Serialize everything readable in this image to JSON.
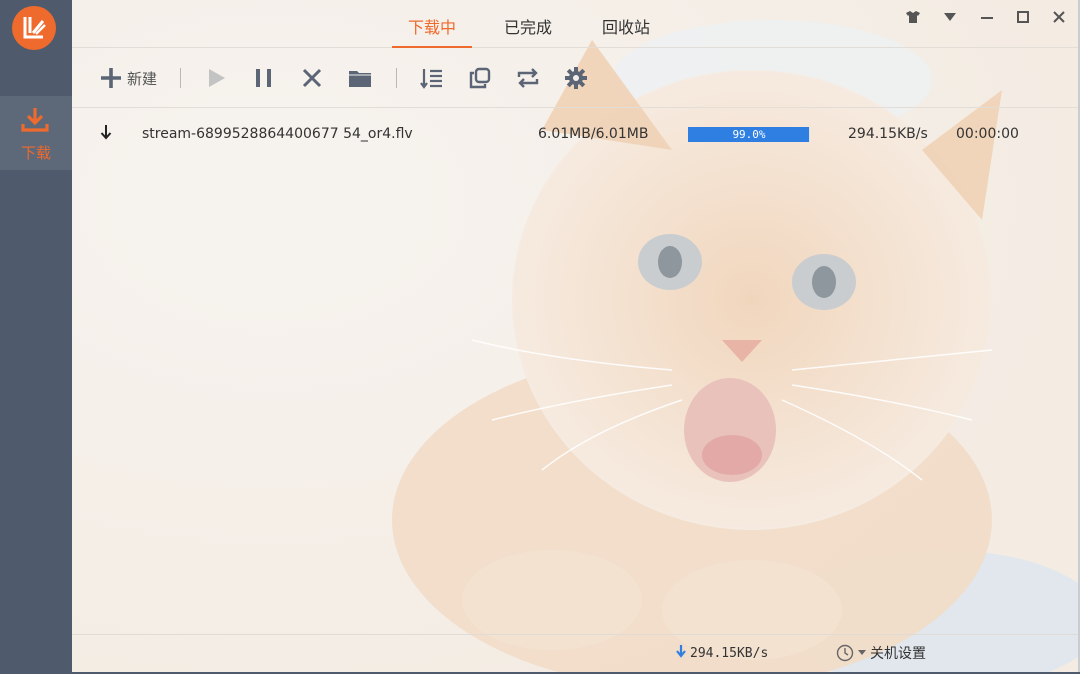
{
  "sidebar": {
    "logo_icon": "app-logo",
    "items": [
      {
        "label": "下载",
        "icon": "download-icon",
        "active": true
      }
    ]
  },
  "tabs": [
    {
      "label": "下载中",
      "active": true
    },
    {
      "label": "已完成",
      "active": false
    },
    {
      "label": "回收站",
      "active": false
    }
  ],
  "window_controls": [
    "skin-icon",
    "menu-dropdown-icon",
    "minimize-icon",
    "maximize-icon",
    "close-icon"
  ],
  "toolbar": {
    "new_label": "新建",
    "buttons": [
      "plus-icon",
      "play-icon",
      "pause-icon",
      "delete-icon",
      "folder-icon",
      "sort-icon",
      "copy-icon",
      "repeat-icon",
      "gear-icon"
    ]
  },
  "downloads": [
    {
      "filename": "stream-6899528864400677 54_or4.flv",
      "size": "6.01MB/6.01MB",
      "progress_text": "99.0%",
      "progress_value": 0.99,
      "speed": "294.15KB/s",
      "remaining": "00:00:00"
    }
  ],
  "statusbar": {
    "speed": "294.15KB/s",
    "shutdown_label": "关机设置"
  },
  "colors": {
    "accent": "#ef6a2d",
    "sidebar": "#4f5b6c",
    "progress": "#2f7fe3"
  }
}
